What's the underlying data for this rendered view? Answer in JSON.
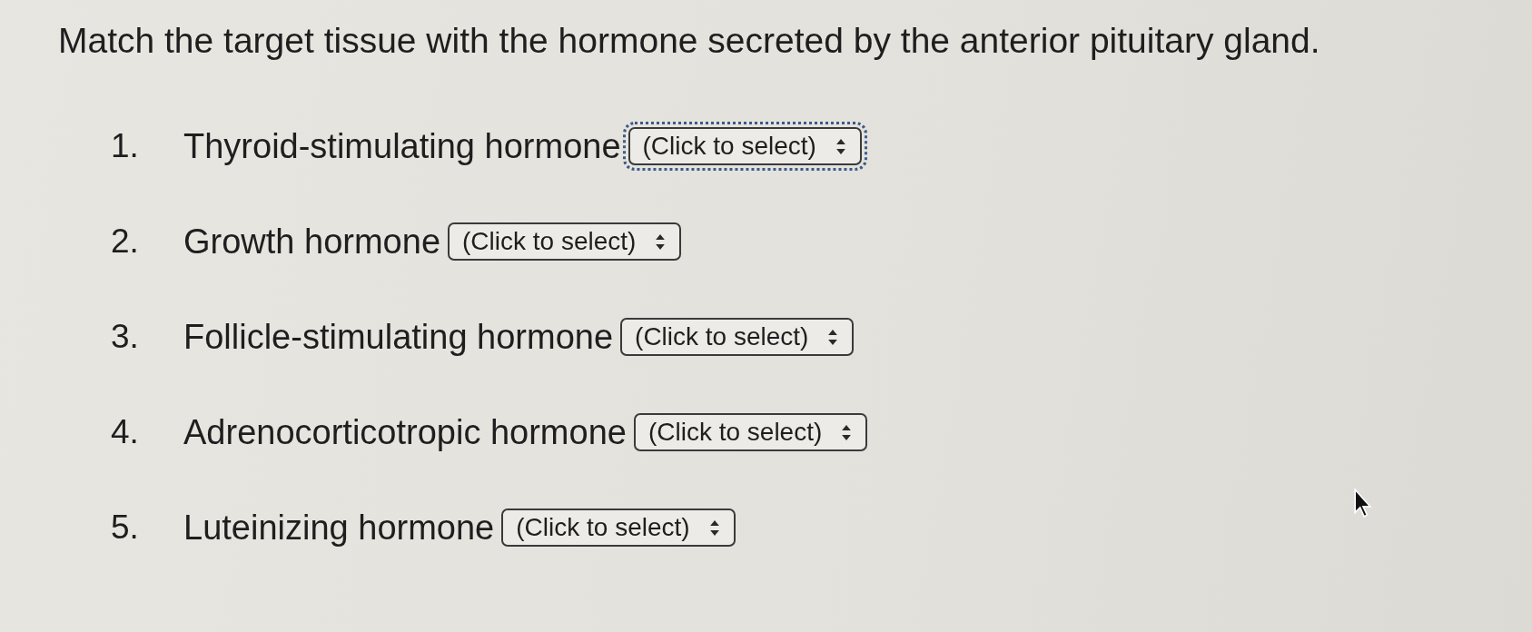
{
  "instruction": "Match the target tissue with the hormone secreted by the anterior pituitary gland.",
  "items": [
    {
      "number": "1.",
      "label": "Thyroid-stimulating hormone",
      "select": {
        "value": "(Click to select)",
        "focused": true
      }
    },
    {
      "number": "2.",
      "label": "Growth hormone",
      "select": {
        "value": "(Click to select)",
        "focused": false
      }
    },
    {
      "number": "3.",
      "label": "Follicle-stimulating hormone",
      "select": {
        "value": "(Click to select)",
        "focused": false
      }
    },
    {
      "number": "4.",
      "label": "Adrenocorticotropic hormone",
      "select": {
        "value": "(Click to select)",
        "focused": false
      }
    },
    {
      "number": "5.",
      "label": "Luteinizing hormone",
      "select": {
        "value": "(Click to select)",
        "focused": false
      }
    }
  ]
}
